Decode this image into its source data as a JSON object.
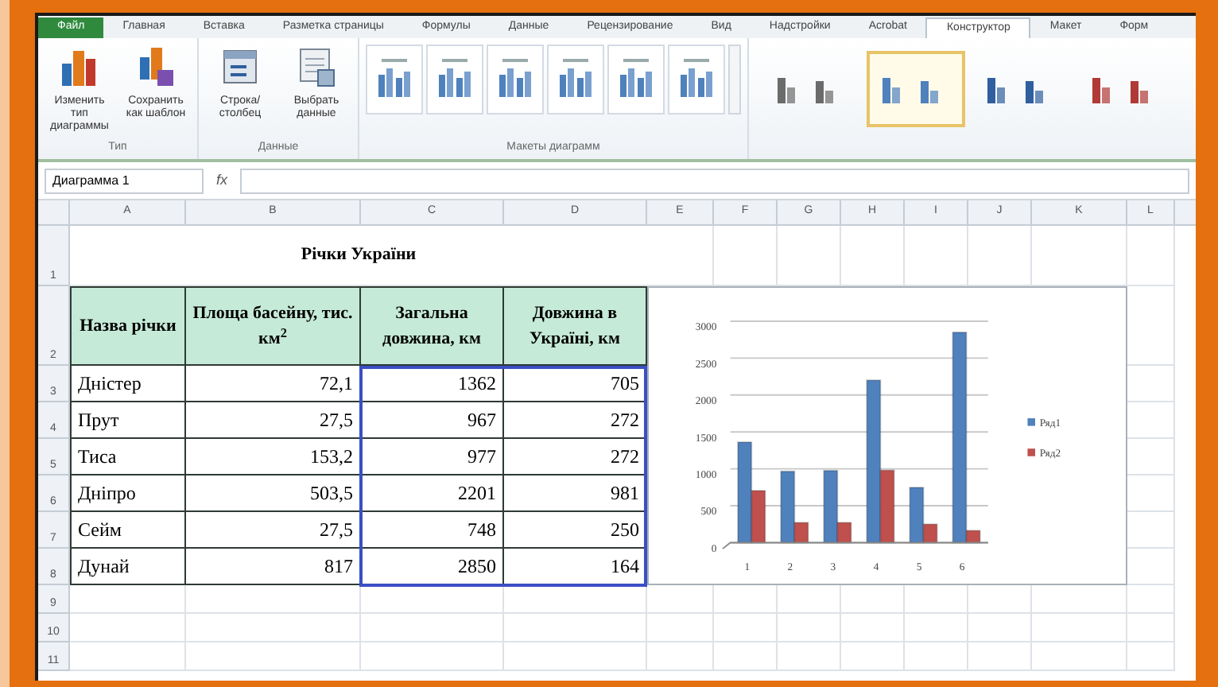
{
  "ribbon_tabs": [
    {
      "label": "Файл",
      "kind": "file",
      "selected": false
    },
    {
      "label": "Главная",
      "kind": "tab",
      "selected": false
    },
    {
      "label": "Вставка",
      "kind": "tab",
      "selected": false
    },
    {
      "label": "Разметка страницы",
      "kind": "tab",
      "selected": false
    },
    {
      "label": "Формулы",
      "kind": "tab",
      "selected": false
    },
    {
      "label": "Данные",
      "kind": "tab",
      "selected": false
    },
    {
      "label": "Рецензирование",
      "kind": "tab",
      "selected": false
    },
    {
      "label": "Вид",
      "kind": "tab",
      "selected": false
    },
    {
      "label": "Надстройки",
      "kind": "tab",
      "selected": false
    },
    {
      "label": "Acrobat",
      "kind": "tab",
      "selected": false
    },
    {
      "label": "Конструктор",
      "kind": "tab",
      "selected": true
    },
    {
      "label": "Макет",
      "kind": "tab",
      "selected": false
    },
    {
      "label": "Форм",
      "kind": "tab",
      "selected": false
    }
  ],
  "ribbon_groups": [
    {
      "kind": "buttons",
      "label": "Тип",
      "buttons": [
        "Изменить тип диаграммы",
        "Сохранить как шаблон"
      ]
    },
    {
      "kind": "buttons",
      "label": "Данные",
      "buttons": [
        "Строка/столбец",
        "Выбрать данные"
      ]
    },
    {
      "kind": "layouts",
      "label": "Макеты диаграмм"
    },
    {
      "kind": "styles",
      "styles": [
        {
          "color": "#6b6b6b",
          "selected": false
        },
        {
          "color": "#4f81bd",
          "selected": true
        },
        {
          "color": "#2f5f9e",
          "selected": false
        },
        {
          "color": "#b03a36",
          "selected": false
        }
      ]
    }
  ],
  "formula_bar": {
    "name_box": "Диаграмма 1",
    "function_label": "fx"
  },
  "columns": [
    "A",
    "B",
    "C",
    "D",
    "E",
    "F",
    "G",
    "H",
    "I",
    "J",
    "K",
    "L"
  ],
  "row_numbers": [
    "1",
    "2",
    "3",
    "4",
    "5",
    "6",
    "7",
    "8",
    "9",
    "10",
    "11"
  ],
  "table": {
    "title": "Річки України",
    "headers": [
      "Назва річки",
      "Площа басейну, тис. км$^{2}$",
      "Загальна довжина, км",
      "Довжина в Україні, км"
    ],
    "source_range_highlight": true,
    "rows": [
      [
        "Дністер",
        "72,1",
        "1362",
        "705"
      ],
      [
        "Прут",
        "27,5",
        "967",
        "272"
      ],
      [
        "Тиса",
        "153,2",
        "977",
        "272"
      ],
      [
        "Дніпро",
        "503,5",
        "2201",
        "981"
      ],
      [
        "Сейм",
        "27,5",
        "748",
        "250"
      ],
      [
        "Дунай",
        "817",
        "2850",
        "164"
      ]
    ]
  },
  "chart": {
    "chart_data": {
      "type": "bar",
      "legend": "right",
      "grid": true,
      "categories": [
        "1",
        "2",
        "3",
        "4",
        "5",
        "6"
      ],
      "ylim": [
        0,
        3000
      ],
      "yticks": [
        0,
        500,
        1000,
        1500,
        2000,
        2500,
        3000
      ],
      "series": [
        {
          "name": "Ряд1",
          "color": "#4f81bd",
          "values": [
            1362,
            967,
            977,
            2201,
            748,
            2850
          ]
        },
        {
          "name": "Ряд2",
          "color": "#c0504d",
          "values": [
            705,
            272,
            272,
            981,
            250,
            164
          ]
        }
      ]
    }
  }
}
